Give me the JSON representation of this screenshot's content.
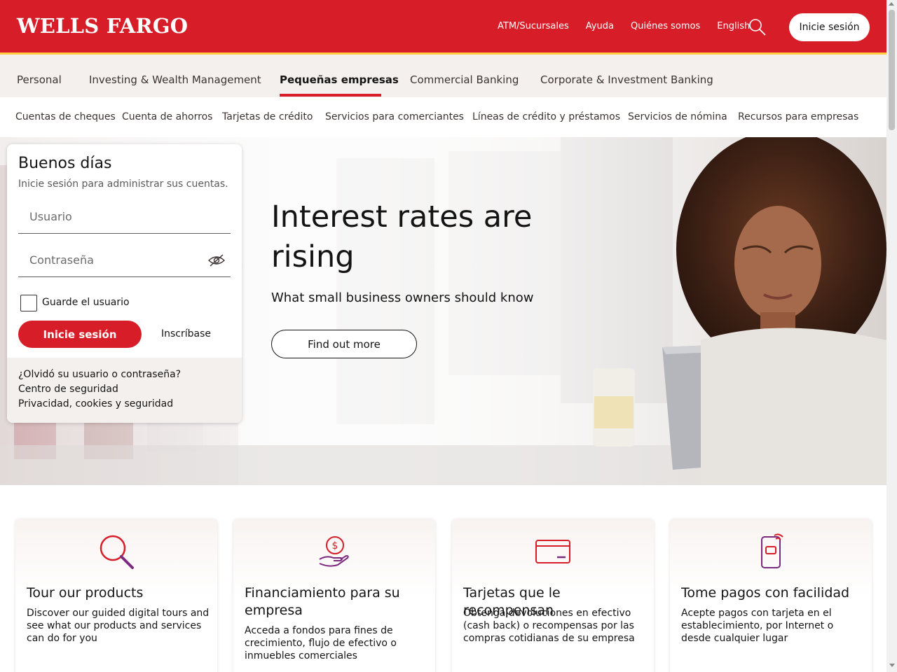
{
  "brand": {
    "logo": "WELLS FARGO",
    "primary_color": "#d71e28",
    "accent_color": "#ffcd41"
  },
  "header": {
    "links": [
      "ATM/Sucursales",
      "Ayuda",
      "Quiénes somos",
      "English"
    ],
    "search_icon": "search-icon",
    "signin_label": "Inicie sesión"
  },
  "primary_nav": {
    "items": [
      "Personal",
      "Investing & Wealth Management",
      "Pequeñas empresas",
      "Commercial Banking",
      "Corporate & Investment Banking"
    ],
    "active": "Pequeñas empresas"
  },
  "secondary_nav": {
    "items": [
      "Cuentas de cheques",
      "Cuenta de ahorros",
      "Tarjetas de crédito",
      "Servicios para comerciantes",
      "Líneas de crédito y préstamos",
      "Servicios de nómina",
      "Recursos para empresas"
    ]
  },
  "signin": {
    "greeting": "Buenos días",
    "subtitle": "Inicie sesión para administrar sus cuentas.",
    "username_placeholder": "Usuario",
    "password_placeholder": "Contraseña",
    "remember_label": "Guarde el usuario",
    "remember_checked": false,
    "signin_button": "Inicie sesión",
    "enroll_link": "Inscríbase",
    "footer_links": [
      "¿Olvidó su usuario o contraseña?",
      "Centro de seguridad",
      "Privacidad, cookies y seguridad"
    ]
  },
  "hero": {
    "title": "Interest rates are rising",
    "subtitle": "What small business owners should know",
    "cta": "Find out more"
  },
  "features": [
    {
      "icon": "magnifier-icon",
      "title": "Tour our products",
      "description": "Discover our guided digital tours and see what our products and services can do for you"
    },
    {
      "icon": "money-hand-icon",
      "title": "Financiamiento para su empresa",
      "description": "Acceda a fondos para fines de crecimiento, flujo de efectivo o inmuebles comerciales"
    },
    {
      "icon": "credit-card-icon",
      "title": "Tarjetas que le recompensan",
      "description": "Obtenga devoluciones en efectivo (cash back) o recompensas por las compras cotidianas de su empresa"
    },
    {
      "icon": "mobile-payment-icon",
      "title": "Tome pagos con facilidad",
      "description": "Acepte pagos con tarjeta en el establecimiento, por Internet o desde cualquier lugar"
    }
  ]
}
